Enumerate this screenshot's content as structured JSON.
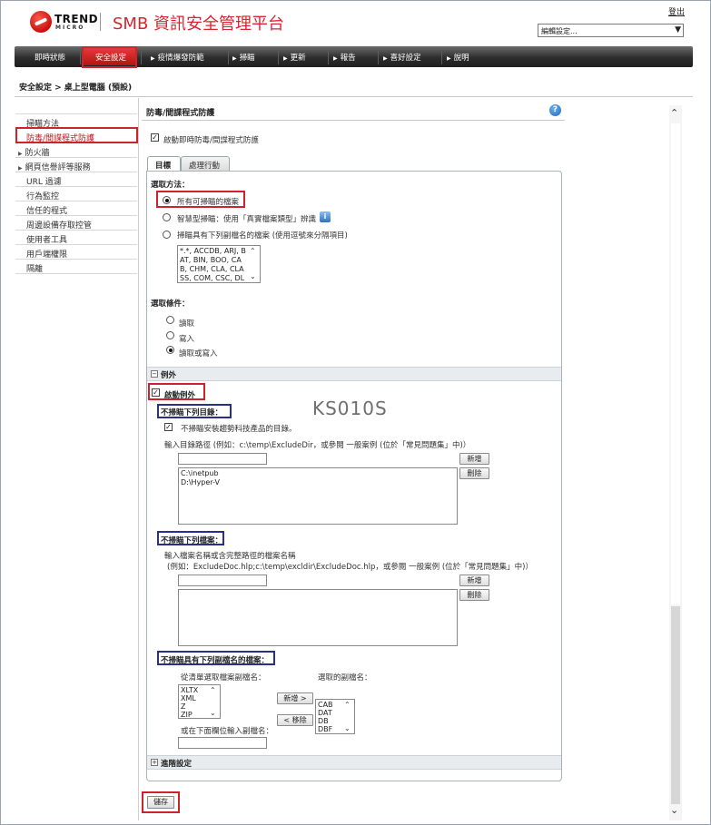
{
  "header": {
    "brand_trend": "TREND",
    "brand_micro": "MICRO",
    "product_title": "SMB 資訊安全管理平台",
    "logout": "登出",
    "edit_settings_select": "編輯設定..."
  },
  "nav": {
    "items": [
      "即時狀態",
      "安全設定",
      "疫情爆發防範",
      "掃瞄",
      "更新",
      "報告",
      "喜好設定",
      "說明"
    ]
  },
  "breadcrumb": "安全設定 > 桌上型電腦 (預設)",
  "sidebar": {
    "items": [
      "掃瞄方法",
      "防毒/間諜程式防護",
      "防火牆",
      "網頁信譽評等服務",
      "URL 過濾",
      "行為監控",
      "信任的程式",
      "周邊設備存取控管",
      "使用者工具",
      "用戶端權限",
      "隔離"
    ]
  },
  "main": {
    "section_title": "防毒/間諜程式防護",
    "help": "?",
    "enable_realtime": "啟動即時防毒/間諜程式防護",
    "tabs": [
      "目標",
      "處理行動"
    ],
    "select_method_label": "選取方法：",
    "method_all": "所有可掃瞄的檔案",
    "method_intellig": "智慧型掃瞄：使用「真實檔案類型」辨識",
    "method_ext": "掃瞄具有下列副檔名的檔案 (使用逗號來分隔項目)",
    "ext_list": "*.*, ACCDB, ARJ, BAT, BIN, BOO, CAB, CHM, CLA, CLASS, COM, CSC, DL",
    "select_condition_label": "選取條件：",
    "cond_read": "讀取",
    "cond_write": "寫入",
    "cond_rw": "讀取或寫入",
    "exclusions_header": "例外",
    "enable_exclusions": "啟動例外",
    "watermark": "KS010S",
    "excl_dirs_title": "不掃瞄下列目錄：",
    "excl_tm_products": "不掃瞄安裝趨勢科技產品的目錄。",
    "dir_path_hint": "輸入目錄路徑 (例如：c:\\temp\\ExcludeDir，或參閱 一般案例 (位於「常見問題集」中)）",
    "dir_list": [
      "C:\\inetpub",
      "D:\\Hyper-V"
    ],
    "add": "新增",
    "remove": "刪除",
    "excl_files_title": "不掃瞄下列檔案：",
    "file_hint_1": "輸入檔案名稱或含完整路徑的檔案名稱",
    "file_hint_2": "(例如：ExcludeDoc.hlp;c:\\temp\\excldir\\ExcludeDoc.hlp，或參閱 一般案例 (位於「常見問題集」中)）",
    "excl_ext_title": "不掃瞄具有下列副檔名的檔案：",
    "choose_from_list": "從清單選取檔案副檔名：",
    "selected_ext_label": "選取的副檔名：",
    "ext_choices": [
      "XLTX",
      "XML",
      "Z",
      "ZIP"
    ],
    "selected_ext": [
      "CAB",
      "DAT",
      "DB",
      "DBF"
    ],
    "add_arrow": "新增 >",
    "remove_arrow": "< 移除",
    "or_enter_ext": "或在下面欄位輸入副檔名：",
    "advanced_header": "進階設定",
    "save": "儲存"
  },
  "colors": {
    "accent_red": "#d0222a",
    "annotation_blue": "#2a2f8f",
    "nav_dark": "#2d2d2d"
  }
}
